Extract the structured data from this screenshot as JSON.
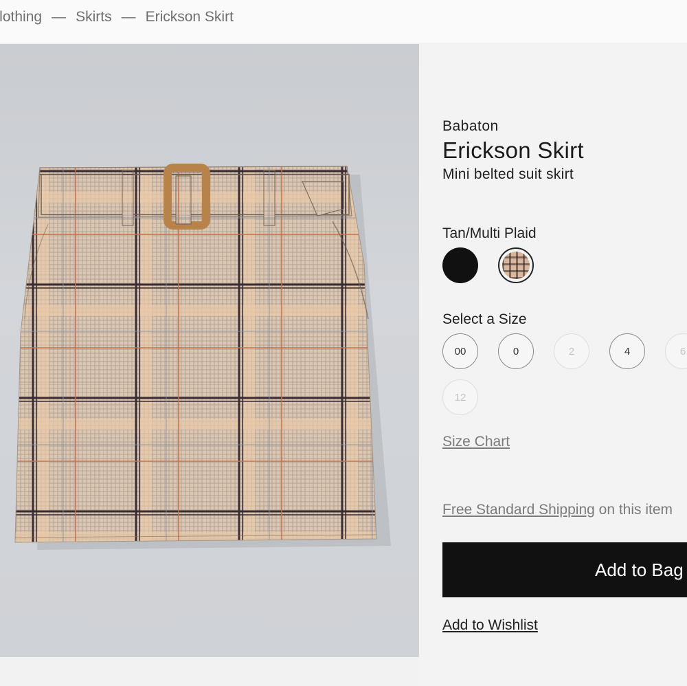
{
  "breadcrumb": {
    "items": [
      "Clothing",
      "Skirts",
      "Erickson Skirt"
    ],
    "separator": "—"
  },
  "product": {
    "brand": "Babaton",
    "name": "Erickson Skirt",
    "subtitle": "Mini belted suit skirt",
    "image_alt": "Tan/Multi Plaid belted mini skirt"
  },
  "color": {
    "selected_label": "Tan/Multi Plaid",
    "swatches": [
      {
        "name": "Black",
        "hex": "#111111",
        "selected": false
      },
      {
        "name": "Tan/Multi Plaid",
        "hex": "#d8b9a0",
        "selected": true
      }
    ]
  },
  "size": {
    "label": "Select a Size",
    "options": [
      {
        "label": "00",
        "available": true
      },
      {
        "label": "0",
        "available": true
      },
      {
        "label": "2",
        "available": false
      },
      {
        "label": "4",
        "available": true
      },
      {
        "label": "6",
        "available": false
      },
      {
        "label": "12",
        "available": false
      }
    ],
    "chart_link": "Size Chart"
  },
  "shipping": {
    "link_text": "Free Standard Shipping",
    "suffix": " on this item"
  },
  "actions": {
    "add_to_bag": "Add to Bag",
    "wishlist": "Add to Wishlist"
  },
  "colors": {
    "page_bg": "#f2f2f2",
    "button_bg": "#111111",
    "muted_text": "#7a7a7a"
  }
}
